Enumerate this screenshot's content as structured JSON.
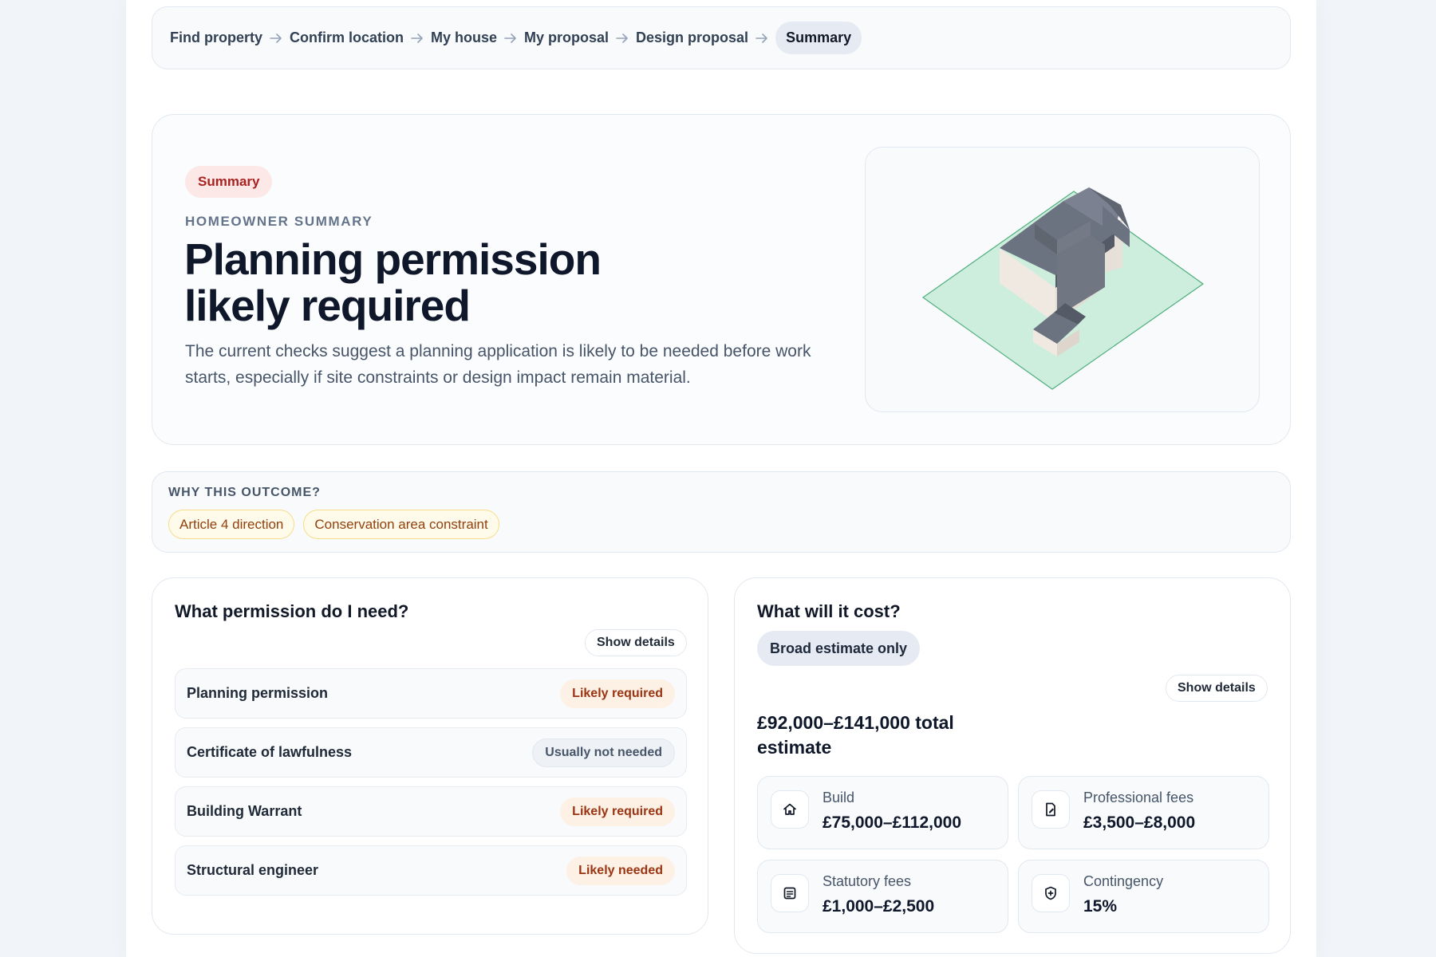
{
  "breadcrumb": {
    "steps": [
      "Find property",
      "Confirm location",
      "My house",
      "My proposal",
      "Design proposal"
    ],
    "current": "Summary"
  },
  "hero": {
    "pill": "Summary",
    "eyebrow": "HOMEOWNER SUMMARY",
    "title": "Planning permission likely required",
    "description": "The current checks suggest a planning application is likely to be needed before work starts, especially if site constraints or design impact remain material."
  },
  "why": {
    "label": "WHY THIS OUTCOME?",
    "tags": [
      "Article 4 direction",
      "Conservation area constraint"
    ]
  },
  "permissions": {
    "title": "What permission do I need?",
    "details_button": "Show details",
    "rows": [
      {
        "name": "Planning permission",
        "status": "Likely required",
        "tone": "warn"
      },
      {
        "name": "Certificate of lawfulness",
        "status": "Usually not needed",
        "tone": "muted"
      },
      {
        "name": "Building Warrant",
        "status": "Likely required",
        "tone": "warn"
      },
      {
        "name": "Structural engineer",
        "status": "Likely needed",
        "tone": "warn"
      }
    ]
  },
  "cost": {
    "title": "What will it cost?",
    "pill": "Broad estimate only",
    "details_button": "Show details",
    "total": "£92,000–£141,000 total estimate",
    "items": [
      {
        "label": "Build",
        "value": "£75,000–£112,000",
        "icon": "home-icon"
      },
      {
        "label": "Professional fees",
        "value": "£3,500–£8,000",
        "icon": "document-edit-icon"
      },
      {
        "label": "Statutory fees",
        "value": "£1,000–£2,500",
        "icon": "form-icon"
      },
      {
        "label": "Contingency",
        "value": "15%",
        "icon": "shield-plus-icon"
      }
    ]
  },
  "colors": {
    "accent_red": "#a8231f",
    "warn_text": "#9a3412",
    "plot_green": "#cdeedd",
    "roof_grey": "#6b7280"
  }
}
